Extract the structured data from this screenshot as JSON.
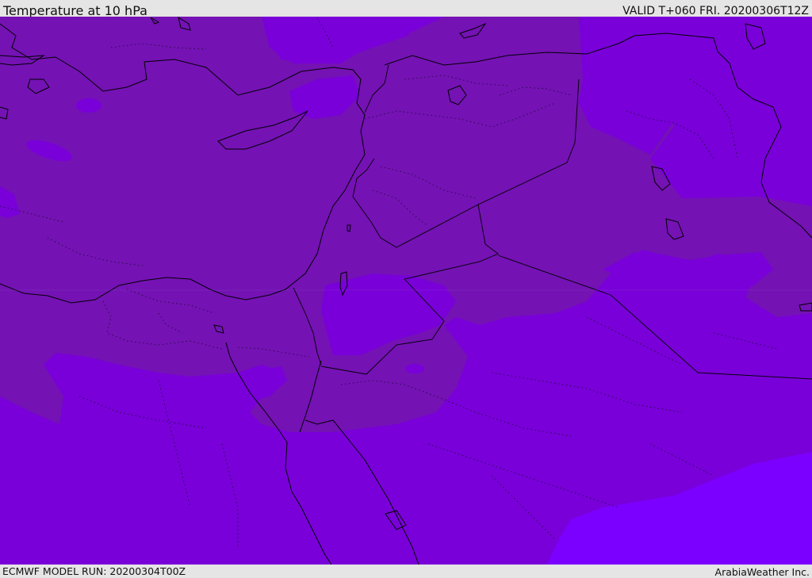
{
  "header": {
    "title": "Temperature at 10 hPa",
    "valid_time": "VALID T+060 FRI. 20200306T12Z"
  },
  "footer": {
    "model_run": "ECMWF MODEL RUN: 20200304T00Z",
    "credit": "ArabiaWeather Inc."
  },
  "map": {
    "colors": {
      "warm_band": "#7412b4",
      "mid_band": "#7900d9",
      "cool_band": "#7b00ff",
      "coast_line": "#000000",
      "region_border": "#1c0a2c"
    }
  }
}
